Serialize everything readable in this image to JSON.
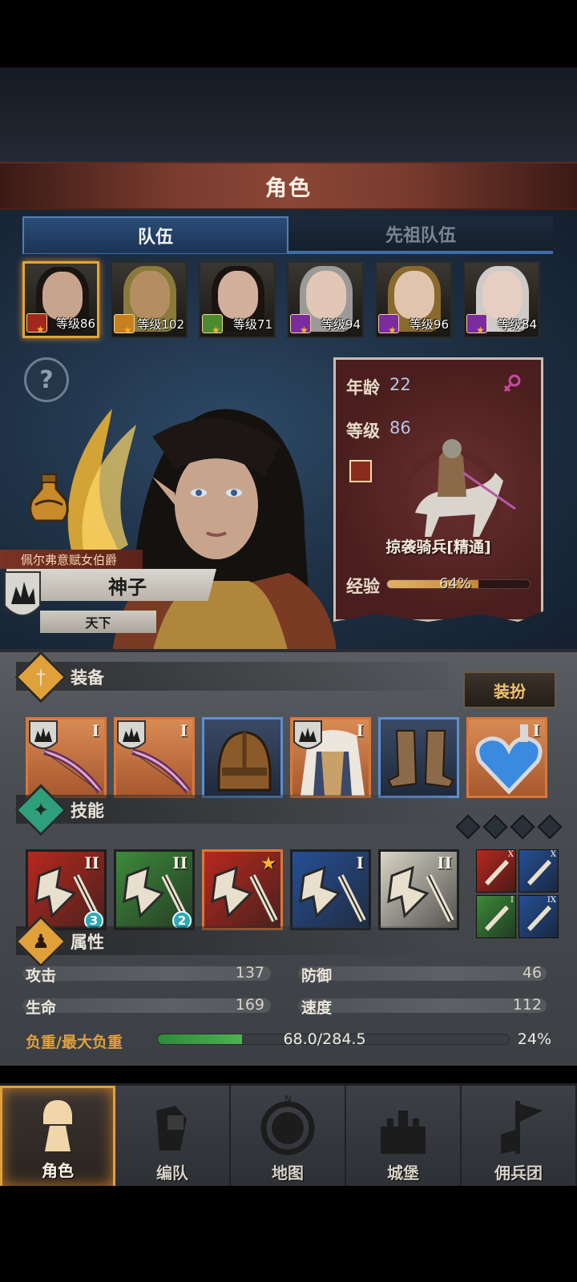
{
  "header": {
    "title": "角色"
  },
  "tabs": [
    {
      "label": "队伍",
      "active": true
    },
    {
      "label": "先祖队伍",
      "active": false
    }
  ],
  "roster": [
    {
      "level_text": "等级86",
      "class_color": "#a3281c",
      "hair": "#1b1512",
      "skin": "#c9a48c",
      "selected": true
    },
    {
      "level_text": "等级102",
      "class_color": "#c8801e",
      "hair": "#8a7a3a",
      "skin": "#b48e62",
      "selected": false
    },
    {
      "level_text": "等级71",
      "class_color": "#4c8a2e",
      "hair": "#1a1410",
      "skin": "#d2b09c",
      "selected": false
    },
    {
      "level_text": "等级94",
      "class_color": "#7a2ba0",
      "hair": "#9c9a98",
      "skin": "#e2c6b6",
      "selected": false
    },
    {
      "level_text": "等级96",
      "class_color": "#7a2ba0",
      "hair": "#8a6a2c",
      "skin": "#e0c4ae",
      "selected": false
    },
    {
      "level_text": "等级84",
      "class_color": "#7a2ba0",
      "hair": "#cfcbc6",
      "skin": "#e6cfc2",
      "selected": false
    }
  ],
  "hero": {
    "title": "佩尔弗意赋女伯爵",
    "name": "神子",
    "faction": "天下"
  },
  "info": {
    "age_label": "年龄",
    "age_value": "22",
    "level_label": "等级",
    "level_value": "86",
    "unit_name": "掠袭骑兵[精通]",
    "exp_label": "经验",
    "exp_text": "64%",
    "exp_fraction": 0.64
  },
  "equipment": {
    "title": "装备",
    "dress_button": "装扮",
    "slots": [
      {
        "name": "bow-1",
        "tier": "I",
        "style": "orange"
      },
      {
        "name": "bow-2",
        "tier": "I",
        "style": "orange"
      },
      {
        "name": "helmet",
        "tier": "",
        "style": "blue"
      },
      {
        "name": "armor",
        "tier": "I",
        "style": "orange"
      },
      {
        "name": "boots",
        "tier": "",
        "style": "blue"
      },
      {
        "name": "amulet",
        "tier": "I",
        "style": "orange"
      }
    ]
  },
  "skills": {
    "title": "技能",
    "slots": [
      {
        "tier": "II",
        "badge": "3",
        "color": "#b7281e"
      },
      {
        "tier": "II",
        "badge": "2",
        "color": "#3c8a3a"
      },
      {
        "tier": "★",
        "badge": "",
        "color": "#b7281e"
      },
      {
        "tier": "I",
        "badge": "",
        "color": "#254f96"
      },
      {
        "tier": "II",
        "badge": "",
        "color": "#d8d4c6"
      }
    ],
    "passives": [
      {
        "tier": "X",
        "color": "#b7281e"
      },
      {
        "tier": "X",
        "color": "#254f96"
      },
      {
        "tier": "I",
        "color": "#3c8a3a"
      },
      {
        "tier": "IX",
        "color": "#254f96"
      }
    ]
  },
  "attributes": {
    "title": "属性",
    "attack_label": "攻击",
    "attack_value": "137",
    "defense_label": "防御",
    "defense_value": "46",
    "hp_label": "生命",
    "hp_value": "169",
    "speed_label": "速度",
    "speed_value": "112",
    "load_label": "负重/最大负重",
    "load_value": "68.0/284.5",
    "load_pct": "24%",
    "load_fraction": 0.24
  },
  "nav": [
    {
      "label": "角色",
      "icon": "knight-icon",
      "active": true
    },
    {
      "label": "编队",
      "icon": "formation-icon",
      "active": false
    },
    {
      "label": "地图",
      "icon": "compass-map-icon",
      "active": false
    },
    {
      "label": "城堡",
      "icon": "castle-icon",
      "active": false
    },
    {
      "label": "佣兵团",
      "icon": "mercenary-banner-icon",
      "active": false
    }
  ],
  "colors": {
    "accent_gold": "#e0a13b",
    "tab_blue": "#3e6da7",
    "header_red": "#8a4636"
  }
}
